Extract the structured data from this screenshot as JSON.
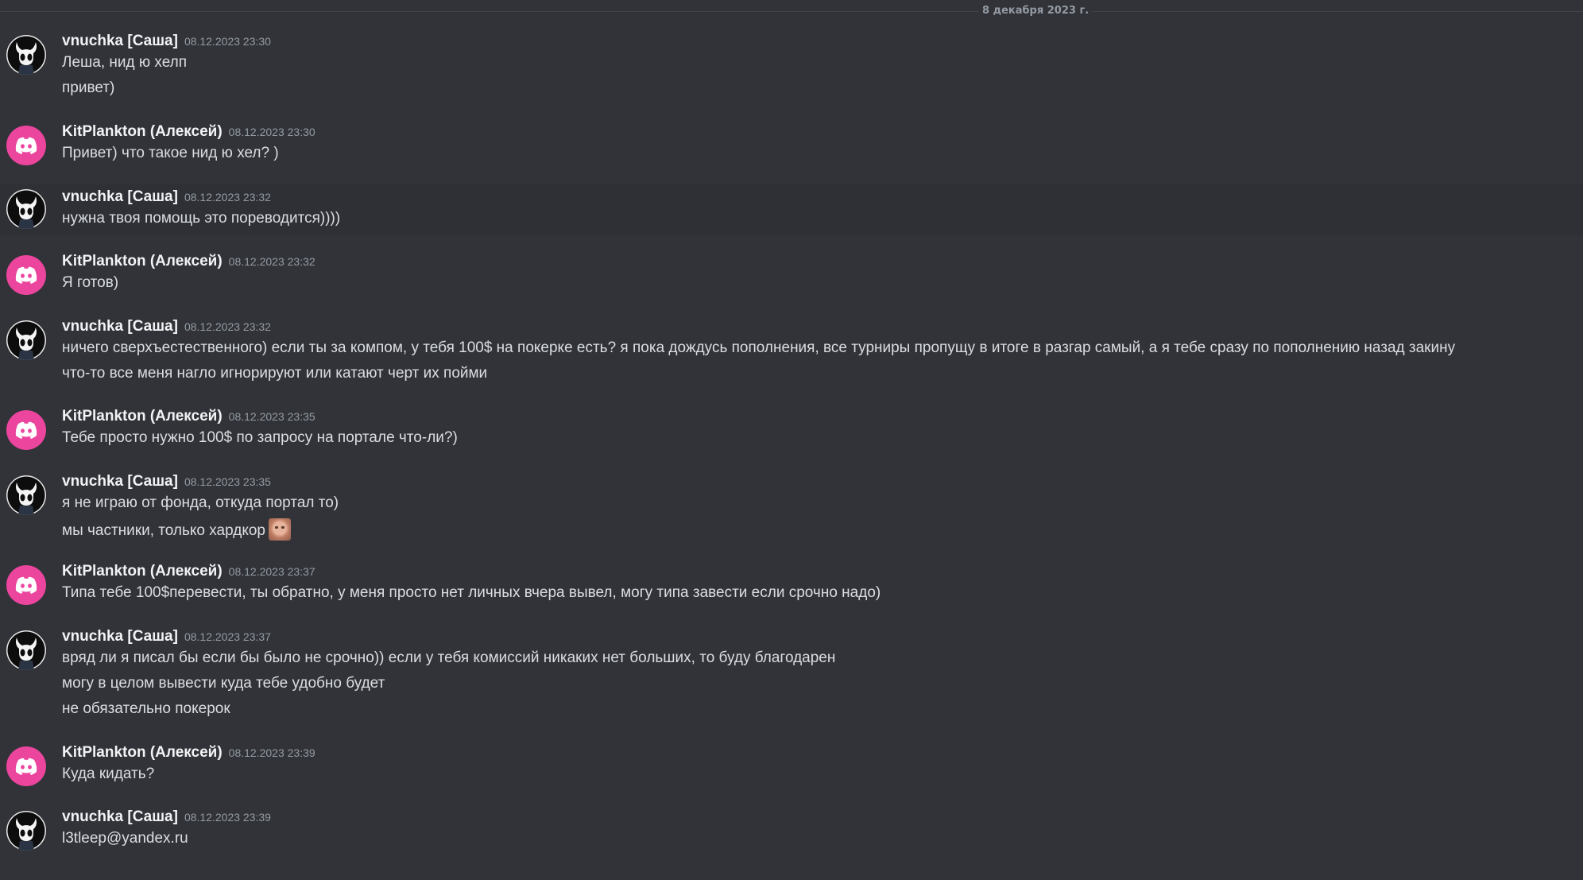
{
  "date_divider": "8 декабря 2023 г.",
  "colors": {
    "background": "#313338",
    "username": "#f2f3f5",
    "timestamp": "#949ba4",
    "text": "#dbdee1",
    "discord_avatar": "#eb459e"
  },
  "messages": [
    {
      "author": "vnuchka [Саша]",
      "avatar": "hollow-knight-avatar",
      "time": "08.12.2023 23:30",
      "lines": [
        "Леша, нид ю хелп",
        "привет)"
      ]
    },
    {
      "author": "KitPlankton (Алексей)",
      "avatar": "discord-default-avatar",
      "time": "08.12.2023 23:30",
      "lines": [
        "Привет) что такое нид ю хел? )"
      ]
    },
    {
      "author": "vnuchka [Саша]",
      "avatar": "hollow-knight-avatar",
      "time": "08.12.2023 23:32",
      "lines": [
        "нужна твоя помощь это пореводится))))"
      ]
    },
    {
      "author": "KitPlankton (Алексей)",
      "avatar": "discord-default-avatar",
      "time": "08.12.2023 23:32",
      "lines": [
        "Я готов)"
      ]
    },
    {
      "author": "vnuchka [Саша]",
      "avatar": "hollow-knight-avatar",
      "time": "08.12.2023 23:32",
      "lines": [
        "ничего сверхъестественного) если ты за компом, у тебя 100$ на покерке есть? я пока дождусь пополнения, все турниры пропущу в итоге в разгар самый, а я тебе сразу по пополнению назад закину",
        "что-то все меня нагло игнорируют или катают черт их пойми"
      ]
    },
    {
      "author": "KitPlankton (Алексей)",
      "avatar": "discord-default-avatar",
      "time": "08.12.2023 23:35",
      "lines": [
        "Тебе просто нужно 100$ по запросу на портале что-ли?)"
      ]
    },
    {
      "author": "vnuchka [Саша]",
      "avatar": "hollow-knight-avatar",
      "time": "08.12.2023 23:35",
      "lines": [
        "я не играю от фонда, откуда портал то)",
        "мы частники, только хардкор"
      ]
    },
    {
      "author": "KitPlankton (Алексей)",
      "avatar": "discord-default-avatar",
      "time": "08.12.2023 23:37",
      "lines": [
        "Типа тебе 100$перевести, ты обратно, у меня просто нет личных вчера вывел, могу типа завести если срочно надо)"
      ]
    },
    {
      "author": "vnuchka [Саша]",
      "avatar": "hollow-knight-avatar",
      "time": "08.12.2023 23:37",
      "lines": [
        "вряд ли я писал бы если бы было не срочно)) если у тебя комиссий никаких нет больших, то буду благодарен",
        "могу в целом вывести куда тебе удобно будет",
        "не обязательно покерок"
      ]
    },
    {
      "author": "KitPlankton (Алексей)",
      "avatar": "discord-default-avatar",
      "time": "08.12.2023 23:39",
      "lines": [
        "Куда кидать?"
      ]
    },
    {
      "author": "vnuchka [Саша]",
      "avatar": "hollow-knight-avatar",
      "time": "08.12.2023 23:39",
      "lines": [
        "l3tleep@yandex.ru"
      ]
    }
  ]
}
